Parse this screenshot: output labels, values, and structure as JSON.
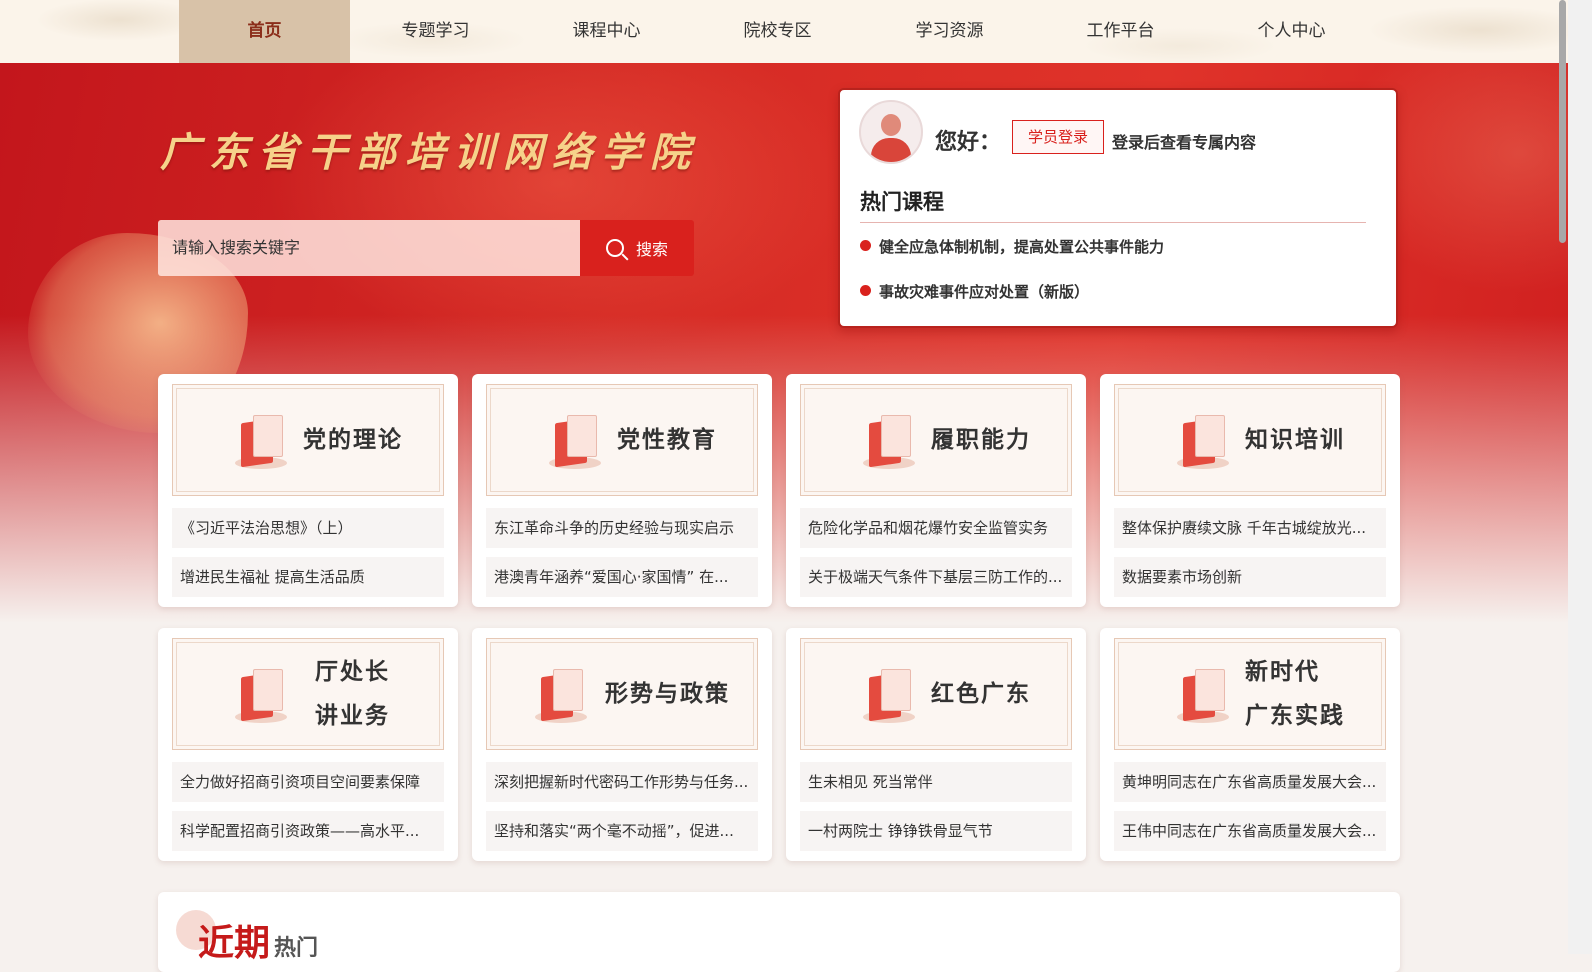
{
  "nav": {
    "items": [
      {
        "label": "首页",
        "active": true
      },
      {
        "label": "专题学习"
      },
      {
        "label": "课程中心"
      },
      {
        "label": "院校专区"
      },
      {
        "label": "学习资源"
      },
      {
        "label": "工作平台"
      },
      {
        "label": "个人中心"
      }
    ]
  },
  "hero": {
    "site_title": "广东省干部培训网络学院",
    "search": {
      "placeholder": "请输入搜索关键字",
      "button_label": "搜索"
    }
  },
  "login_card": {
    "greeting": "您好：",
    "login_button": "学员登录",
    "hint": "登录后查看专属内容",
    "hot_title": "热门课程",
    "hot_courses": [
      "健全应急体制机制，提高处置公共事件能力",
      "事故灾难事件应对处置（新版）"
    ]
  },
  "categories": [
    {
      "label": "党的理论",
      "icon": "book-magnifier-icon",
      "items": [
        "《习近平法治思想》（上）",
        "增进民生福祉 提高生活品质"
      ]
    },
    {
      "label": "党性教育",
      "icon": "party-flag-book-icon",
      "items": [
        "东江革命斗争的历史经验与现实启示",
        "港澳青年涵养“爱国心·家国情” 在..."
      ]
    },
    {
      "label": "履职能力",
      "icon": "id-badge-icon",
      "items": [
        "危险化学品和烟花爆竹安全监管实务",
        "关于极端天气条件下基层三防工作的..."
      ]
    },
    {
      "label": "知识培训",
      "icon": "document-stack-icon",
      "items": [
        "整体保护赓续文脉 千年古城绽放光...",
        "数据要素市场创新"
      ]
    },
    {
      "label1": "厅处长",
      "label2": "讲业务",
      "icon": "speaker-podium-icon",
      "items": [
        "全力做好招商引资项目空间要素保障",
        "科学配置招商引资政策——高水平..."
      ]
    },
    {
      "label": "形势与政策",
      "icon": "policy-document-icon",
      "items": [
        "深刻把握新时代密码工作形势与任务...",
        "坚持和落实“两个毫不动摇”，促进..."
      ]
    },
    {
      "label": "红色广东",
      "icon": "red-building-icon",
      "items": [
        "生未相见 死当常伴",
        "一村两院士 铮铮铁骨显气节"
      ]
    },
    {
      "label1": "新时代",
      "label2": "广东实践",
      "icon": "city-skyline-icon",
      "items": [
        "黄坤明同志在广东省高质量发展大会...",
        "王伟中同志在广东省高质量发展大会..."
      ]
    }
  ],
  "bottom": {
    "title": "近期",
    "subtitle": "热门"
  },
  "colors": {
    "brand_red": "#d9211d",
    "nav_active": "#d8c2a8",
    "title_gold": "#f6d28a"
  }
}
